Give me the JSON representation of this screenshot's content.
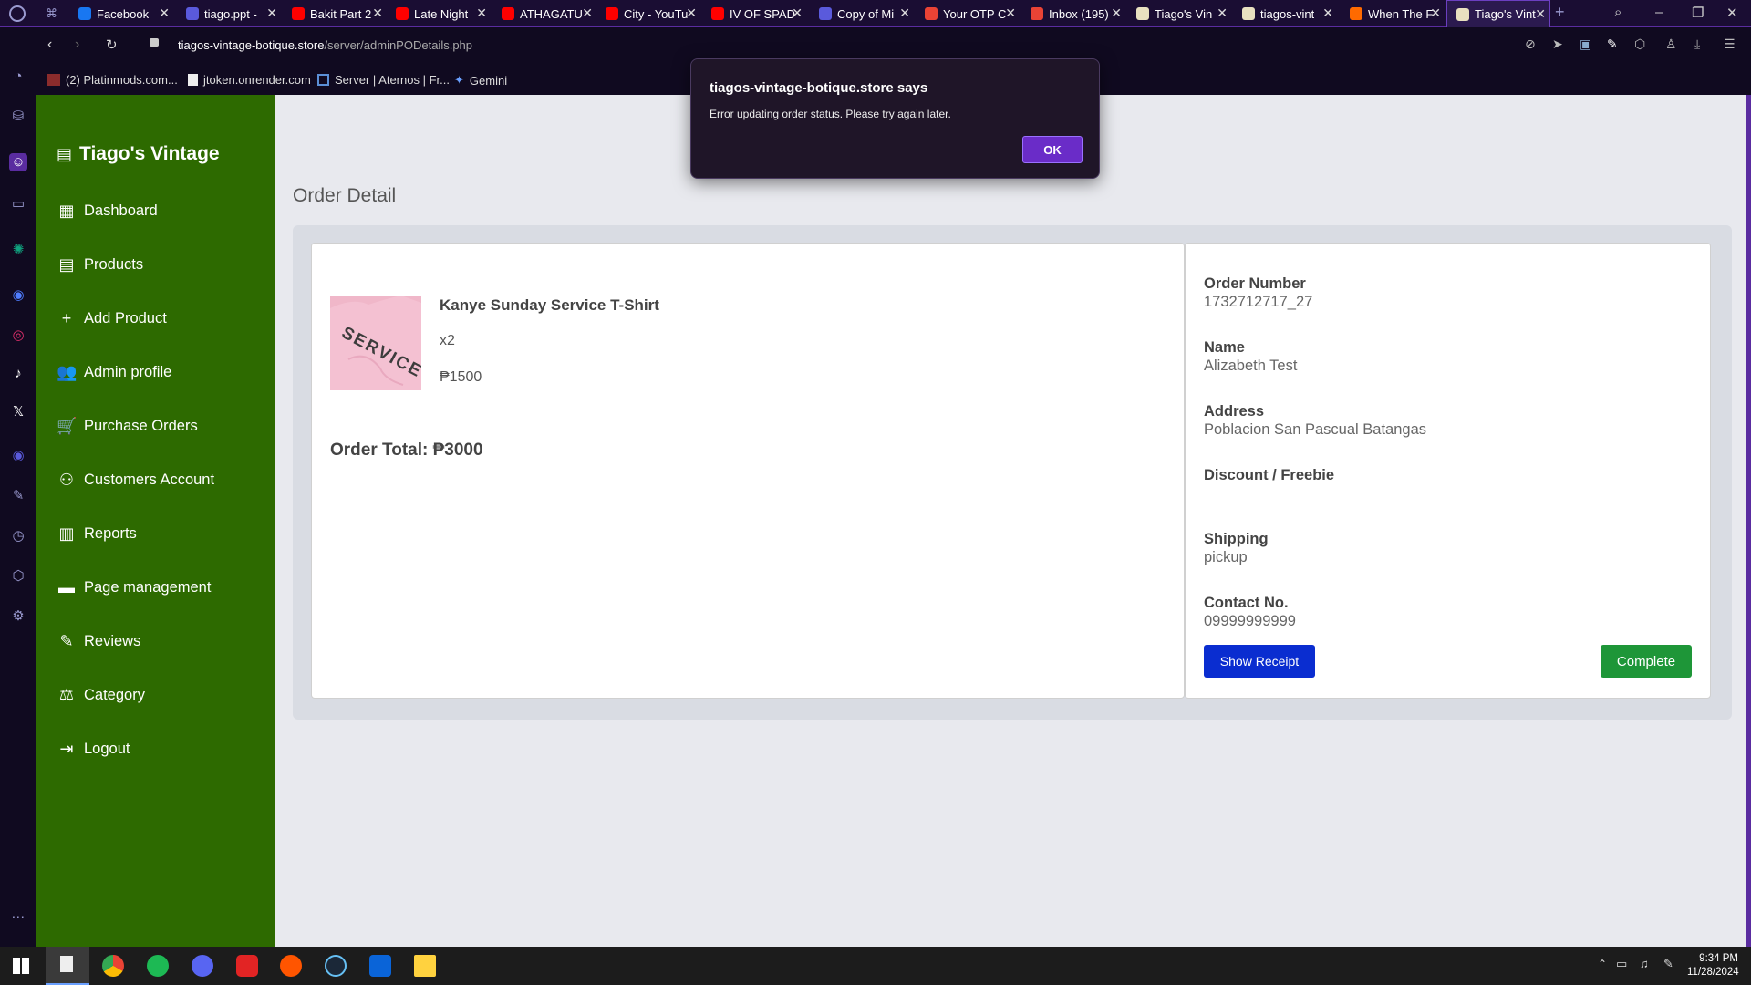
{
  "browser": {
    "tabs": [
      {
        "label": "Facebook",
        "color": "#1877f2"
      },
      {
        "label": "tiago.ppt -",
        "color": "#5a5adc"
      },
      {
        "label": "Bakit Part 2",
        "color": "#ff0000"
      },
      {
        "label": "Late Night",
        "color": "#ff0000"
      },
      {
        "label": "ATHAGATU",
        "color": "#ff0000"
      },
      {
        "label": "City - YouTu",
        "color": "#ff0000"
      },
      {
        "label": "IV OF SPAD",
        "color": "#ff0000"
      },
      {
        "label": "Copy of Mi",
        "color": "#5a5adc"
      },
      {
        "label": "Your OTP C",
        "color": "#ea4335"
      },
      {
        "label": "Inbox (195)",
        "color": "#ea4335"
      },
      {
        "label": "Tiago's Vin",
        "color": "#e8e0c0"
      },
      {
        "label": "tiagos-vint",
        "color": "#e8e0c0"
      },
      {
        "label": "When The F",
        "color": "#ff6a00"
      },
      {
        "label": "Tiago's Vint",
        "color": "#e8e0c0"
      }
    ],
    "url_host": "tiagos-vintage-botique.store",
    "url_path": "/server/adminPODetails.php",
    "bookmarks": [
      "(2) Platinmods.com...",
      "jtoken.onrender.com",
      "Server | Aternos | Fr...",
      "Gemini"
    ]
  },
  "sidebar": {
    "brand": "Tiago's Vintage",
    "items": [
      {
        "label": "Dashboard",
        "icon": "dashboard-icon"
      },
      {
        "label": "Products",
        "icon": "archive-icon"
      },
      {
        "label": "Add Product",
        "icon": "plus-icon"
      },
      {
        "label": "Admin profile",
        "icon": "users-icon"
      },
      {
        "label": "Purchase Orders",
        "icon": "cart-icon"
      },
      {
        "label": "Customers Account",
        "icon": "group-icon"
      },
      {
        "label": "Reports",
        "icon": "chart-icon"
      },
      {
        "label": "Page management",
        "icon": "layout-icon"
      },
      {
        "label": "Reviews",
        "icon": "review-icon"
      },
      {
        "label": "Category",
        "icon": "category-icon"
      },
      {
        "label": "Logout",
        "icon": "logout-icon"
      }
    ]
  },
  "page": {
    "title": "Order Detail",
    "product": {
      "name": "Kanye Sunday Service T-Shirt",
      "qty": "x2",
      "price": "₱1500",
      "shirt_text": "SERVICE"
    },
    "order_total": "Order Total: ₱3000",
    "details": [
      {
        "label": "Order Number",
        "value": "1732712717_27"
      },
      {
        "label": "Name",
        "value": "Alizabeth Test"
      },
      {
        "label": "Address",
        "value": "Poblacion San Pascual Batangas"
      },
      {
        "label": "Discount / Freebie",
        "value": ""
      },
      {
        "label": "Shipping",
        "value": "pickup"
      },
      {
        "label": "Contact No.",
        "value": "09999999999"
      }
    ],
    "show_receipt_label": "Show Receipt",
    "complete_label": "Complete"
  },
  "dialog": {
    "title": "tiagos-vintage-botique.store says",
    "message": "Error updating order status. Please try again later.",
    "ok_label": "OK"
  },
  "taskbar": {
    "time": "9:34 PM",
    "date": "11/28/2024"
  }
}
